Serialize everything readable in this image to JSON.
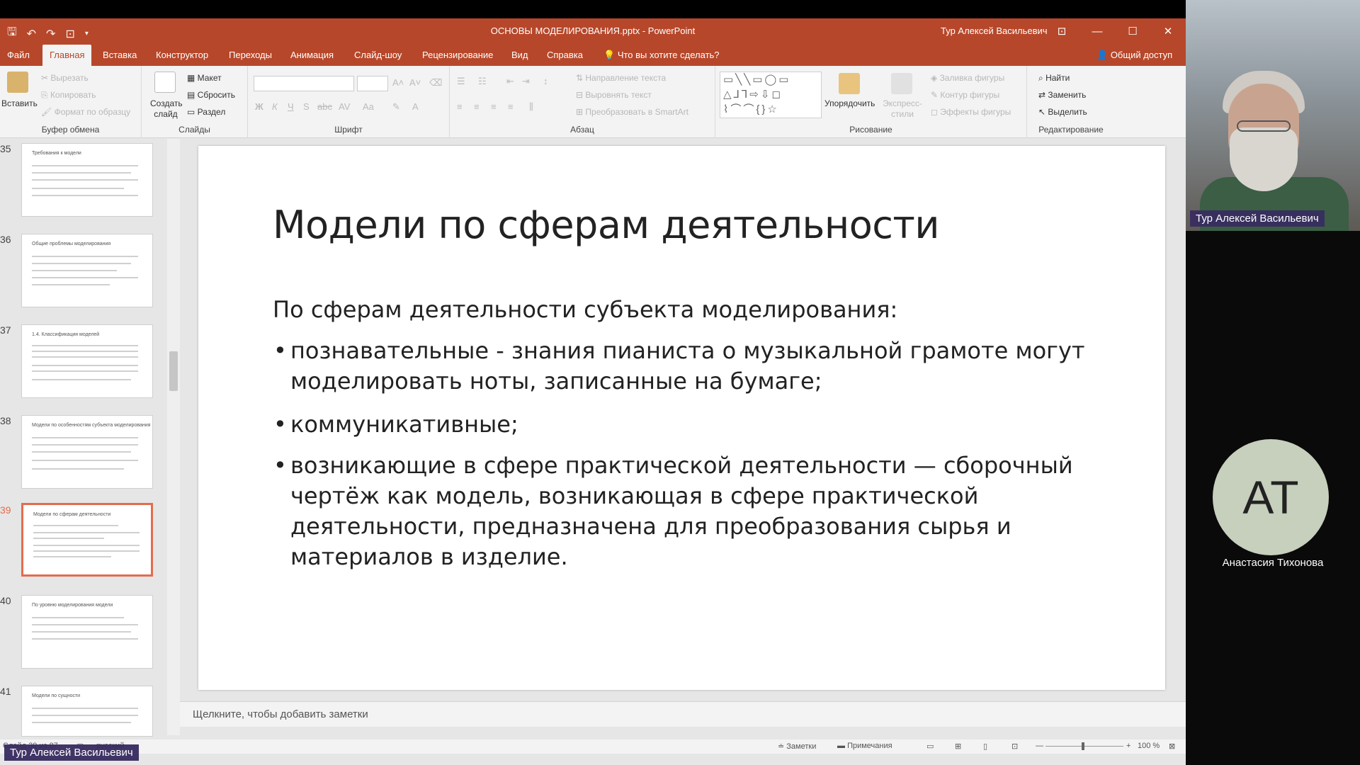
{
  "window": {
    "doc_title": "ОСНОВЫ МОДЕЛИРОВАНИЯ.pptx  -  PowerPoint",
    "user_name": "Тур Алексей Васильевич",
    "controls": [
      "⊡",
      "—",
      "☐",
      "✕"
    ]
  },
  "tabs": [
    {
      "label": "Файл"
    },
    {
      "label": "Главная"
    },
    {
      "label": "Вставка"
    },
    {
      "label": "Конструктор"
    },
    {
      "label": "Переходы"
    },
    {
      "label": "Анимация"
    },
    {
      "label": "Слайд-шоу"
    },
    {
      "label": "Рецензирование"
    },
    {
      "label": "Вид"
    },
    {
      "label": "Справка"
    }
  ],
  "tell_me": "Что вы хотите сделать?",
  "share": "Общий доступ",
  "ribbon": {
    "clipboard": {
      "label": "Буфер обмена",
      "paste": "Вставить",
      "cut": "Вырезать",
      "copy": "Копировать",
      "format": "Формат по образцу"
    },
    "slides": {
      "label": "Слайды",
      "new_slide": "Создать слайд",
      "layout": "Макет",
      "reset": "Сбросить",
      "section": "Раздел"
    },
    "font": {
      "label": "Шрифт"
    },
    "paragraph": {
      "label": "Абзац",
      "text_direction": "Направление текста",
      "align_text": "Выровнять текст",
      "smartart": "Преобразовать в SmartArt"
    },
    "drawing": {
      "label": "Рисование",
      "arrange": "Упорядочить",
      "quick_styles": "Экспресс-стили",
      "fill": "Заливка фигуры",
      "outline": "Контур фигуры",
      "effects": "Эффекты фигуры"
    },
    "editing": {
      "label": "Редактирование",
      "find": "Найти",
      "replace": "Заменить",
      "select": "Выделить"
    }
  },
  "thumbnails": [
    {
      "num": "35",
      "title": "Требования к модели"
    },
    {
      "num": "36",
      "title": "Общие проблемы моделирования"
    },
    {
      "num": "37",
      "title": "1.4. Классификация моделей"
    },
    {
      "num": "38",
      "title": "Модели по особенностям субъекта моделирования"
    },
    {
      "num": "39",
      "title": "Модели по сферам деятельности"
    },
    {
      "num": "40",
      "title": "По уровню моделирования модели"
    },
    {
      "num": "41",
      "title": "Модели по сущности"
    }
  ],
  "slide": {
    "title": "Модели по сферам деятельности",
    "subtitle": "По сферам деятельности субъекта моделирования:",
    "bullets": [
      "познавательные - знания пианиста о музыкальной грамоте могут моделировать ноты, записанные на бумаге;",
      "коммуникативные;",
      "возникающие в сфере практической деятельности — сборочный чертёж как модель, возникающая в сфере практической деятельности, предназначена для преобразования сырья и материалов в изделие."
    ]
  },
  "notes_placeholder": "Щелкните, чтобы добавить заметки",
  "status": {
    "slide_info": "Слайд 39 из 87",
    "language": "русский",
    "notes": "Заметки",
    "comments": "Примечания",
    "zoom": "100 %"
  },
  "video": {
    "presenter_name": "Тур Алексей Васильевич",
    "participant_initials": "АТ",
    "participant_name": "Анастасия Тихонова",
    "bottom_label": "Тур Алексей Васильевич"
  }
}
